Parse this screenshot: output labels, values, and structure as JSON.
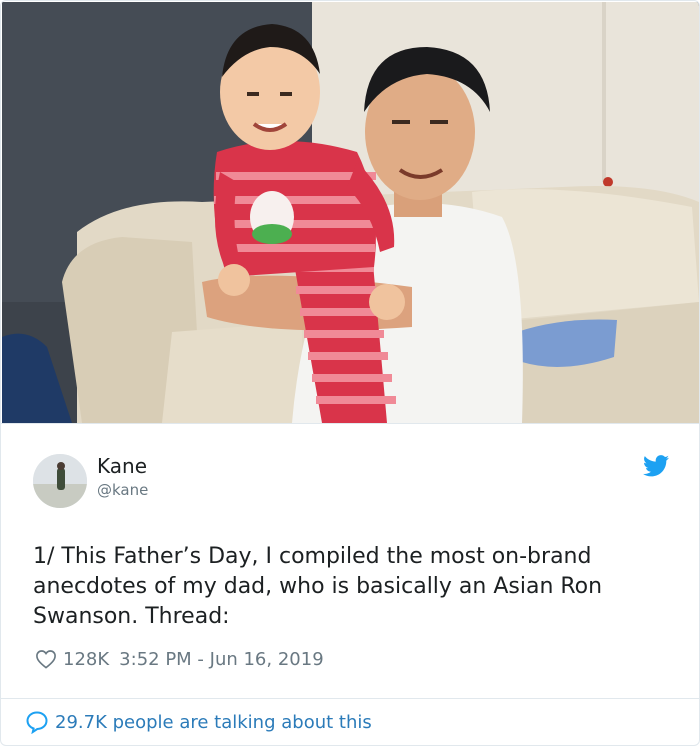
{
  "tweet": {
    "display_name": "Kane",
    "handle": "@kane",
    "text": "1/ This Father’s Day, I compiled the most on-brand anecdotes of my dad, who is basically an Asian Ron Swanson. Thread:",
    "likes": "128K",
    "timestamp": "3:52 PM - Jun 16, 2019",
    "conversation": "29.7K people are talking about this"
  },
  "icons": {
    "brand": "twitter-bird-icon",
    "like": "heart-icon",
    "reply": "speech-bubble-icon"
  },
  "colors": {
    "twitter_blue": "#1da1f2",
    "link_blue": "#2b7bb9",
    "muted_text": "#697882",
    "body_text": "#1c2022",
    "border": "#e1e8ed"
  }
}
